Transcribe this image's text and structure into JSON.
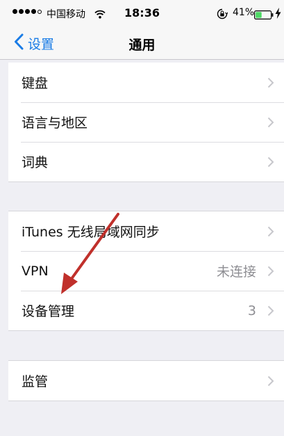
{
  "status_bar": {
    "carrier": "中国移动",
    "time": "18:36",
    "battery_percent": "41%",
    "battery_level": 0.41,
    "signal_bars_filled": 4,
    "signal_bars_total": 5,
    "icons": [
      "signal-dots-icon",
      "wifi-icon",
      "orientation-lock-icon",
      "battery-icon",
      "charging-bolt-icon"
    ]
  },
  "nav": {
    "back_label": "设置",
    "title": "通用"
  },
  "groups": [
    {
      "rows": [
        {
          "label": "键盘",
          "detail": ""
        },
        {
          "label": "语言与地区",
          "detail": ""
        },
        {
          "label": "词典",
          "detail": ""
        }
      ]
    },
    {
      "rows": [
        {
          "label": "iTunes 无线局域网同步",
          "detail": ""
        },
        {
          "label": "VPN",
          "detail": "未连接"
        },
        {
          "label": "设备管理",
          "detail": "3"
        }
      ]
    },
    {
      "rows": [
        {
          "label": "监管",
          "detail": ""
        }
      ]
    }
  ],
  "colors": {
    "accent": "#1a7ce6",
    "background": "#efeff4",
    "annotation_arrow": "#c0302b",
    "battery_fill": "#4cd964"
  }
}
